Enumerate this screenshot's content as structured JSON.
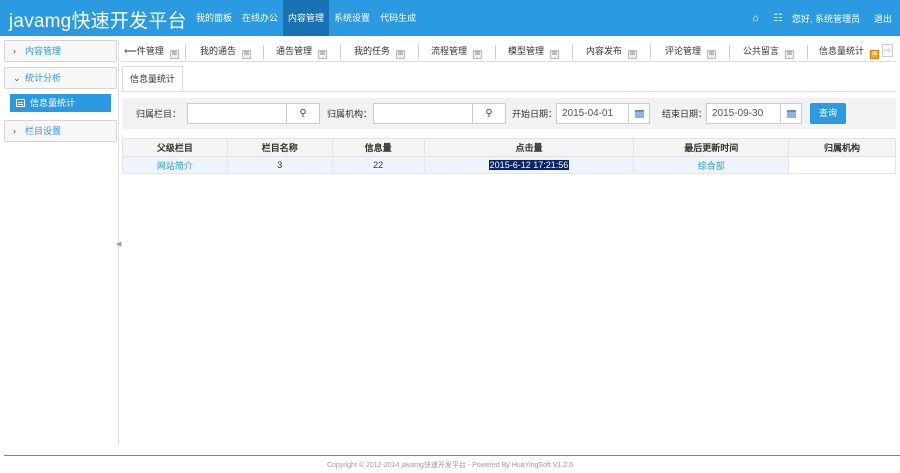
{
  "app": {
    "title": "javamg快速开发平台"
  },
  "topnav": [
    {
      "label": "我的面板",
      "active": false
    },
    {
      "label": "在线办公",
      "active": false
    },
    {
      "label": "内容管理",
      "active": true
    },
    {
      "label": "系统设置",
      "active": false
    },
    {
      "label": "代码生成",
      "active": false
    }
  ],
  "topright": {
    "home_icon": "⌂",
    "grid_icon": "☷",
    "greeting": "您好, 系统管理员",
    "logout": "退出"
  },
  "sidebar": {
    "groups": [
      {
        "label": "内容管理",
        "expanded": false,
        "chevron": "›"
      },
      {
        "label": "统计分析",
        "expanded": true,
        "chevron": "⌄"
      },
      {
        "label": "栏目设置",
        "expanded": false,
        "chevron": "›"
      }
    ],
    "active_item": "信息量统计"
  },
  "tabs": [
    {
      "label": "⟸件管理"
    },
    {
      "label": "我的通告"
    },
    {
      "label": "通告管理"
    },
    {
      "label": "我的任务"
    },
    {
      "label": "流程管理"
    },
    {
      "label": "模型管理"
    },
    {
      "label": "内容发布"
    },
    {
      "label": "评论管理"
    },
    {
      "label": "公共留言"
    },
    {
      "label": "信息量统计",
      "active": true
    }
  ],
  "tab_close_icon": "⊠",
  "inner_tab": "信息量统计",
  "search": {
    "category_label": "归属栏目：",
    "category_value": "",
    "org_label": "归属机构：",
    "org_value": "",
    "search_icon": "🔍",
    "start_label": "开始日期：",
    "start_value": "2015-04-01",
    "end_label": "结束日期：",
    "end_value": "2015-09-30",
    "query_label": "查询"
  },
  "table": {
    "headers": [
      "父级栏目",
      "栏目名称",
      "信息量",
      "点击量",
      "最后更新时间",
      "归属机构"
    ],
    "rows": [
      [
        "网站简介",
        "3",
        "22",
        "2015-6-12 17:21:56",
        "综合部",
        ""
      ]
    ]
  },
  "footer": "Copyright © 2012-2014 javamg快速开发平台 - Powered By HuaYingSoft V1.2.6",
  "colors": {
    "primary": "#2c9ae0",
    "active_nav": "#1872b3",
    "selection": "#0a246a"
  }
}
